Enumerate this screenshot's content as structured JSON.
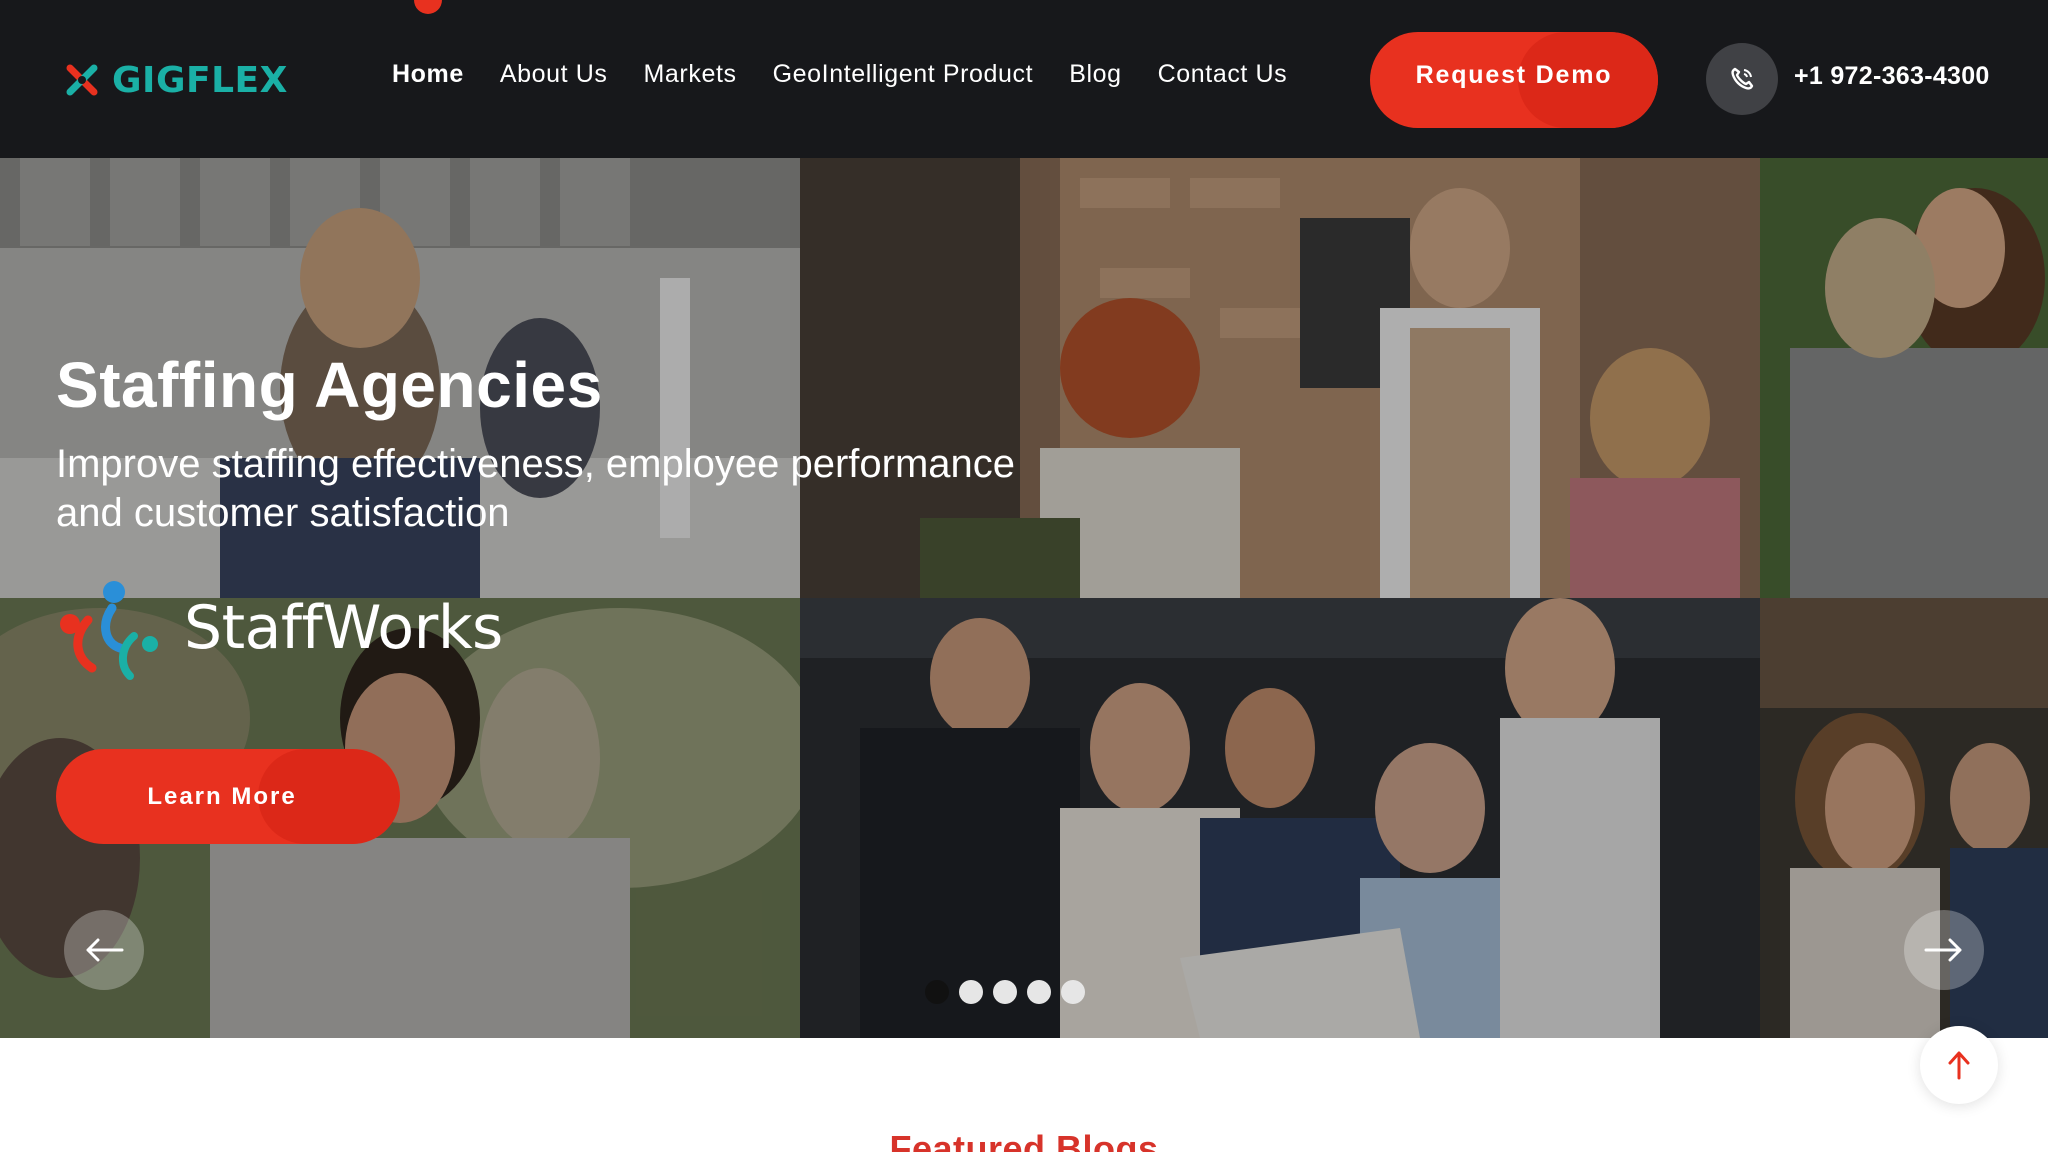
{
  "header": {
    "logo_text": "GIGFLEX",
    "nav": [
      {
        "label": "Home",
        "active": true
      },
      {
        "label": "About Us"
      },
      {
        "label": "Markets"
      },
      {
        "label": "GeoIntelligent Product"
      },
      {
        "label": "Blog"
      },
      {
        "label": "Contact Us"
      }
    ],
    "request_demo_label": "Request Demo",
    "phone_icon": "phone-icon",
    "phone_number": "+1 972-363-4300"
  },
  "hero": {
    "title": "Staffing Agencies",
    "subtitle": "Improve staffing effectiveness, employee performance and customer satisfaction",
    "partner_logo_text": "StaffWorks",
    "learn_more_label": "Learn More",
    "prev_icon": "arrow-left-icon",
    "next_icon": "arrow-right-icon",
    "slide_count": 5,
    "active_slide": 1
  },
  "featured": {
    "title": "Featured Blogs"
  },
  "scroll_top_icon": "arrow-up-icon",
  "colors": {
    "header_bg": "#17181b",
    "accent": "#e8311f",
    "logo": "#1ab0a6",
    "section_title": "#d7332a"
  }
}
